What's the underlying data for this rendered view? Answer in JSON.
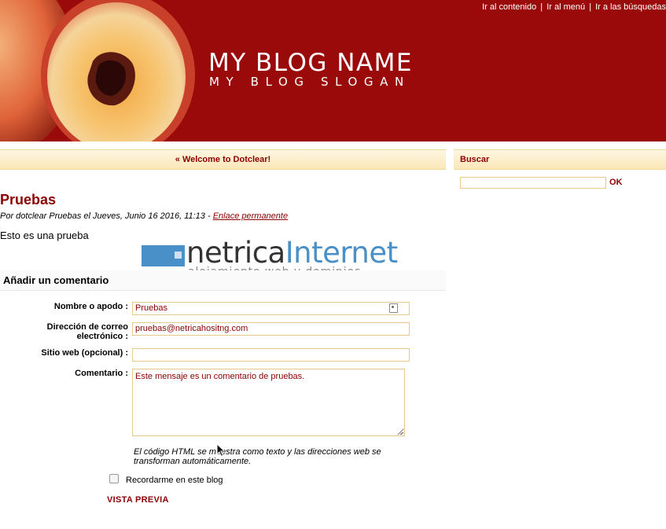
{
  "header": {
    "blog_name": "MY BLOG NAME",
    "blog_slogan": "MY BLOG SLOGAN",
    "skip_links": [
      {
        "label": "Ir al contenido"
      },
      {
        "label": "Ir al menú"
      },
      {
        "label": "Ir a las búsquedas"
      }
    ],
    "separator": "|"
  },
  "nav": {
    "prev_post": "« Welcome to Dotclear!"
  },
  "sidebar": {
    "search_title": "Buscar",
    "search_value": "",
    "search_button": "OK"
  },
  "post": {
    "title": "Pruebas",
    "meta": "Por dotclear Pruebas el Jueves, Junio 16 2016, 11:13 - ",
    "permalink": "Enlace permanente",
    "body": "Esto es una prueba"
  },
  "logo": {
    "text_a": "netrica",
    "text_b": "Internet",
    "tagline": "alojamiento web y dominios"
  },
  "comment_form": {
    "heading": "Añadir un comentario",
    "name_label": "Nombre o apodo :",
    "name_value": "Pruebas",
    "email_label": "Dirección de correo electrónico :",
    "email_value": "pruebas@netricahositng.com",
    "site_label": "Sitio web (opcional) :",
    "site_value": "",
    "comment_label": "Comentario :",
    "comment_value": "Este mensaje es un comentario de pruebas.",
    "help_text": "El código HTML se muestra como texto y las direcciones web se transforman automáticamente.",
    "remember_label": "Recordarme en este blog",
    "remember_checked": false,
    "preview_button": "VISTA PREVIA"
  },
  "colors": {
    "header_bg": "#9a0a0a",
    "accent": "#8b0000",
    "nav_gradient_top": "#fdf6e2",
    "nav_gradient_bottom": "#fbe8b8",
    "logo_blue": "#4a90c8"
  }
}
